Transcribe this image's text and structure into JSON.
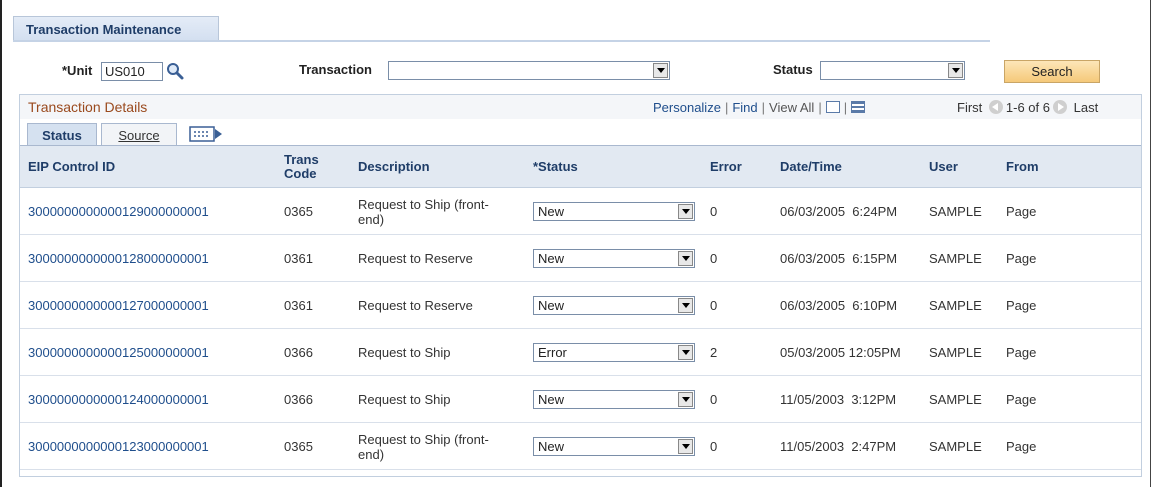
{
  "page_tab": {
    "label": "Transaction Maintenance"
  },
  "search": {
    "unit_label": "*Unit",
    "unit_value": "US010",
    "transaction_label": "Transaction",
    "transaction_value": "",
    "status_label": "Status",
    "status_value": "",
    "search_button": "Search"
  },
  "grid": {
    "title": "Transaction Details",
    "personalize": "Personalize",
    "find": "Find",
    "view_all": "View All",
    "first": "First",
    "range": "1-6 of 6",
    "last": "Last",
    "tabs": [
      {
        "label": "Status",
        "active": true
      },
      {
        "label": "Source",
        "active": false
      }
    ],
    "columns": {
      "eip": "EIP Control ID",
      "trans_code_1": "Trans",
      "trans_code_2": "Code",
      "description": "Description",
      "status": "*Status",
      "error": "Error",
      "datetime": "Date/Time",
      "user": "User",
      "from": "From"
    },
    "rows": [
      {
        "eip": "3000000000000129000000001",
        "code": "0365",
        "desc1": "Request to Ship (front-",
        "desc2": "end)",
        "status": "New",
        "error": "0",
        "datetime": "06/03/2005  6:24PM",
        "user": "SAMPLE",
        "from": "Page"
      },
      {
        "eip": "3000000000000128000000001",
        "code": "0361",
        "desc1": "Request to Reserve",
        "desc2": "",
        "status": "New",
        "error": "0",
        "datetime": "06/03/2005  6:15PM",
        "user": "SAMPLE",
        "from": "Page"
      },
      {
        "eip": "3000000000000127000000001",
        "code": "0361",
        "desc1": "Request to Reserve",
        "desc2": "",
        "status": "New",
        "error": "0",
        "datetime": "06/03/2005  6:10PM",
        "user": "SAMPLE",
        "from": "Page"
      },
      {
        "eip": "3000000000000125000000001",
        "code": "0366",
        "desc1": "Request to Ship",
        "desc2": "",
        "status": "Error",
        "error": "2",
        "datetime": "05/03/2005 12:05PM",
        "user": "SAMPLE",
        "from": "Page"
      },
      {
        "eip": "3000000000000124000000001",
        "code": "0366",
        "desc1": "Request to Ship",
        "desc2": "",
        "status": "New",
        "error": "0",
        "datetime": "11/05/2003  3:12PM",
        "user": "SAMPLE",
        "from": "Page"
      },
      {
        "eip": "3000000000000123000000001",
        "code": "0365",
        "desc1": "Request to Ship (front-",
        "desc2": "end)",
        "status": "New",
        "error": "0",
        "datetime": "11/05/2003  2:47PM",
        "user": "SAMPLE",
        "from": "Page"
      }
    ]
  }
}
